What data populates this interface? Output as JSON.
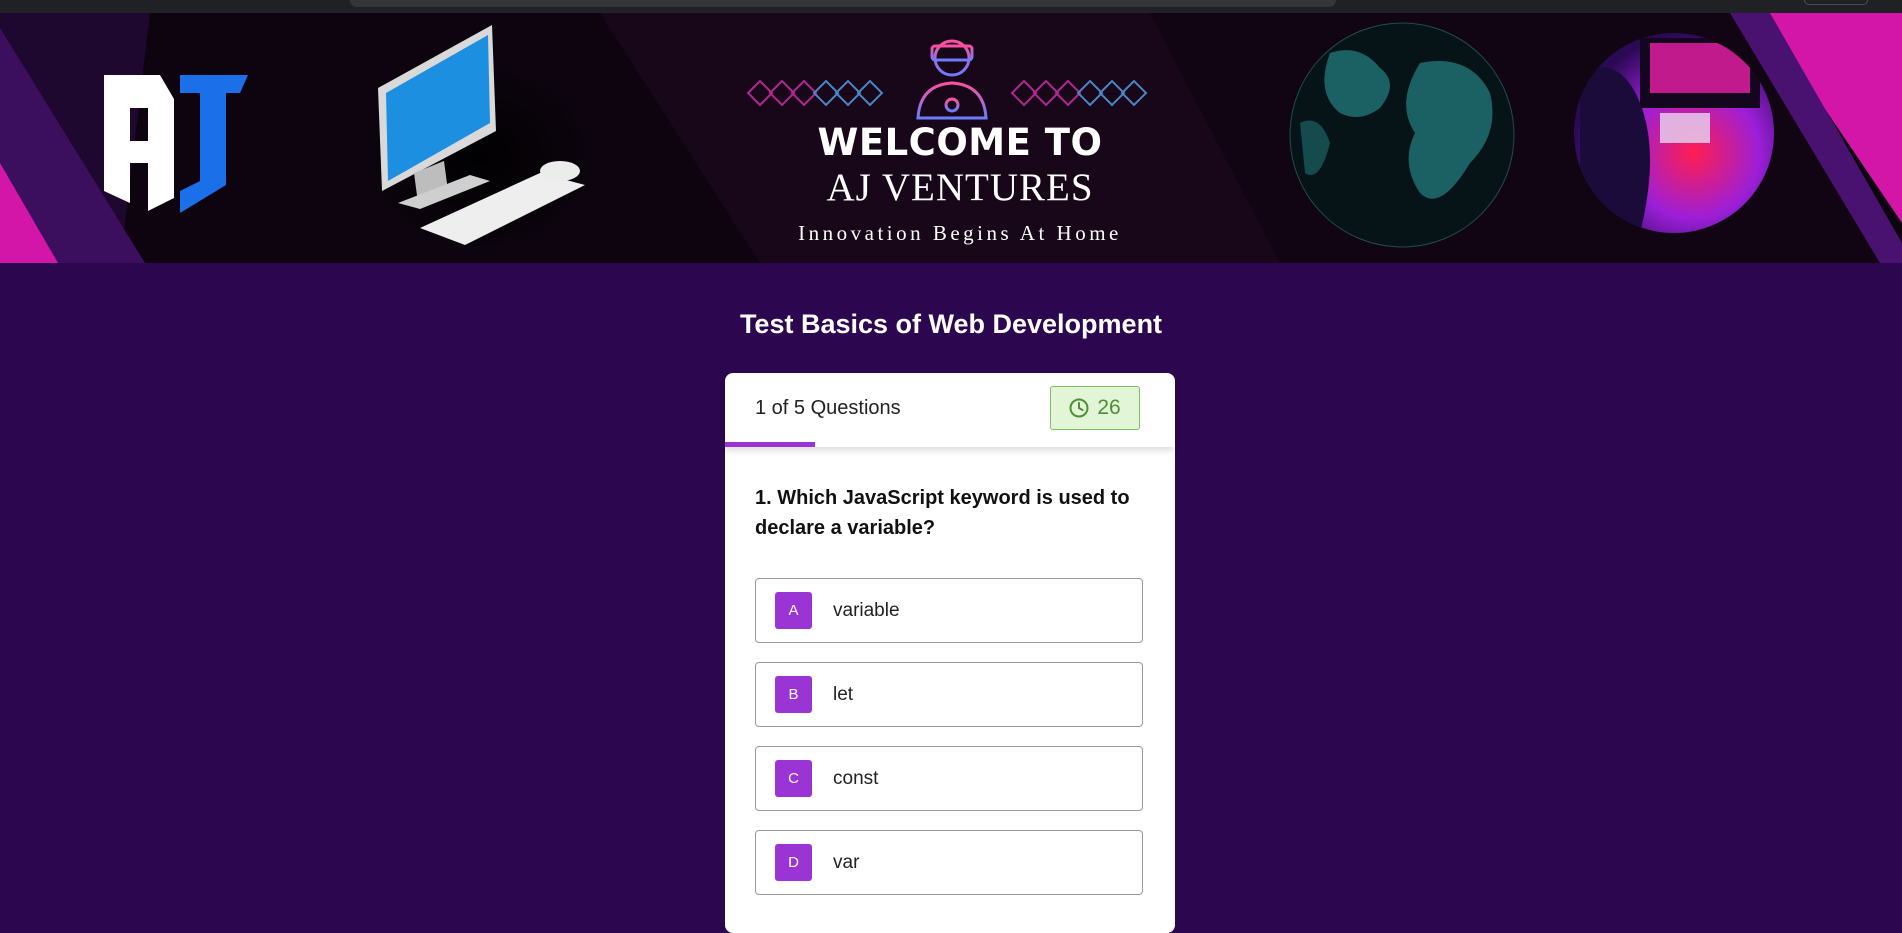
{
  "banner": {
    "heading": "WELCOME TO",
    "company": "AJ VENTURES",
    "tagline": "Innovation Begins At Home",
    "logo_text": "AJ"
  },
  "page": {
    "title": "Test Basics of Web Development"
  },
  "quiz": {
    "counter": "1 of 5 Questions",
    "timer": "26",
    "progress_fraction": 0.2,
    "question": "1. Which JavaScript keyword is used to declare a variable?",
    "options": [
      {
        "letter": "A",
        "text": "variable"
      },
      {
        "letter": "B",
        "text": "let"
      },
      {
        "letter": "C",
        "text": "const"
      },
      {
        "letter": "D",
        "text": "var"
      }
    ]
  },
  "colors": {
    "page_bg": "#2d0650",
    "accent": "#9b34d4",
    "timer_bg": "#e3f5d7",
    "timer_text": "#4d8f37",
    "banner_magenta": "#e0129c"
  },
  "icons": {
    "timer": "clock-icon",
    "banner_center": "vr-gamer-icon"
  }
}
